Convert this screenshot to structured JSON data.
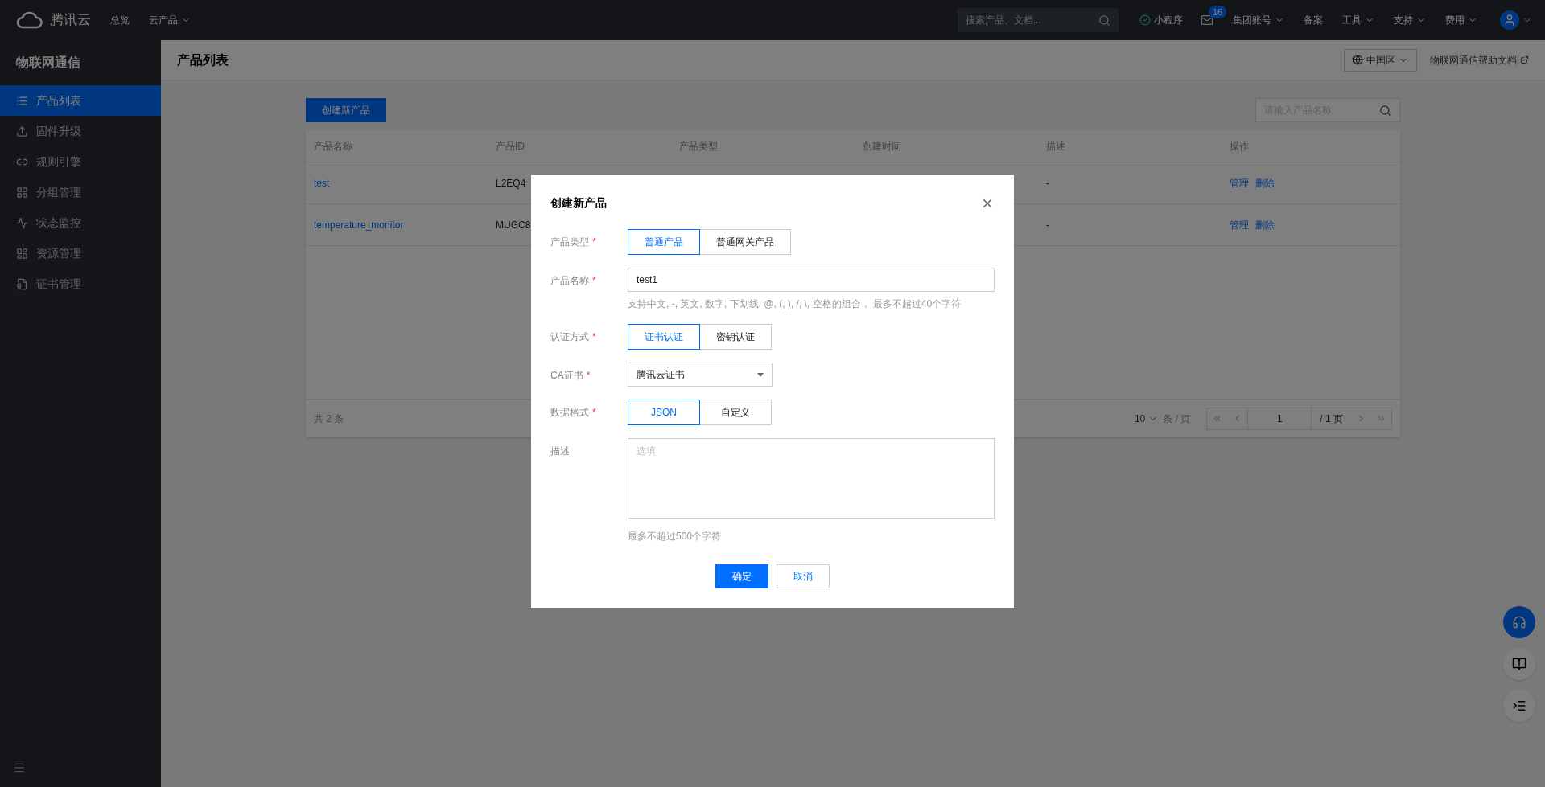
{
  "topbar": {
    "logo": "腾讯云",
    "nav": [
      {
        "label": "总览",
        "dropdown": false
      },
      {
        "label": "云产品",
        "dropdown": true
      }
    ],
    "search": {
      "placeholder": "搜索产品、文档..."
    },
    "miniprogram": "小程序",
    "mail_badge": "16",
    "menus": [
      {
        "label": "集团账号",
        "dropdown": true
      },
      {
        "label": "备案",
        "dropdown": false
      },
      {
        "label": "工具",
        "dropdown": true
      },
      {
        "label": "支持",
        "dropdown": true
      },
      {
        "label": "费用",
        "dropdown": true
      }
    ]
  },
  "sidebar": {
    "title": "物联网通信",
    "items": [
      {
        "label": "产品列表",
        "selected": true
      },
      {
        "label": "固件升级",
        "selected": false
      },
      {
        "label": "规则引擎",
        "selected": false
      },
      {
        "label": "分组管理",
        "selected": false
      },
      {
        "label": "状态监控",
        "selected": false
      },
      {
        "label": "资源管理",
        "selected": false
      },
      {
        "label": "证书管理",
        "selected": false
      }
    ]
  },
  "page": {
    "title": "产品列表",
    "region": "中国区",
    "help_link": "物联网通信帮助文档"
  },
  "toolbar": {
    "create_button": "创建新产品",
    "search": {
      "placeholder": "请输入产品名称"
    }
  },
  "table": {
    "columns": [
      "产品名称",
      "产品ID",
      "产品类型",
      "创建时间",
      "描述",
      "操作"
    ],
    "rows": [
      {
        "name": "test",
        "id": "L2EQ4",
        "description": "-",
        "actions": [
          "管理",
          "删除"
        ]
      },
      {
        "name": "temperature_monitor",
        "id": "MUGC8",
        "description": "-",
        "actions": [
          "管理",
          "删除"
        ]
      }
    ]
  },
  "pagination": {
    "total": "共 2 条",
    "page_size": "10",
    "per_page": "条 / 页",
    "page": "1",
    "pages": "/ 1 页"
  },
  "dialog": {
    "title": "创建新产品",
    "fields": [
      {
        "kind": "segmented",
        "label": "产品类型",
        "required_mark": "*",
        "options": [
          {
            "label": "普通产品",
            "selected": true
          },
          {
            "label": "普通网关产品",
            "selected": false
          }
        ]
      },
      {
        "kind": "input",
        "label": "产品名称",
        "required_mark": "*",
        "value": "test1",
        "hint": "支持中文, -, 英文, 数字, 下划线, @, (, ), /, \\, 空格的组合， 最多不超过40个字符"
      },
      {
        "kind": "segmented",
        "label": "认证方式",
        "required_mark": "*",
        "options": [
          {
            "label": "证书认证",
            "selected": true
          },
          {
            "label": "密钥认证",
            "selected": false
          }
        ]
      },
      {
        "kind": "select",
        "label": "CA证书",
        "required_mark": "*",
        "value": "腾讯云证书"
      },
      {
        "kind": "segmented",
        "label": "数据格式",
        "required_mark": "*",
        "options": [
          {
            "label": "JSON",
            "selected": true
          },
          {
            "label": "自定义",
            "selected": false
          }
        ]
      },
      {
        "kind": "textarea",
        "label": "描述",
        "placeholder": "选填",
        "hint": "最多不超过500个字符"
      }
    ],
    "buttons": [
      {
        "label": "确定",
        "primary": true
      },
      {
        "label": "取消",
        "primary": false
      }
    ]
  }
}
